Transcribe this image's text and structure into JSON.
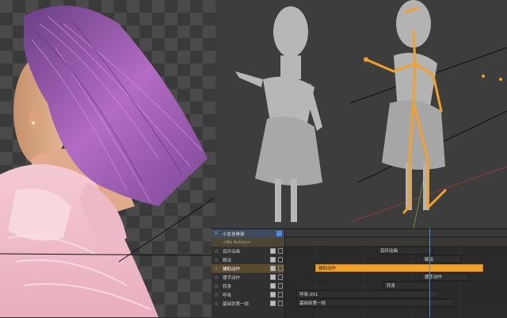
{
  "nla": {
    "tracks": [
      {
        "name": "小女孩骨架",
        "kind": "header"
      },
      {
        "name": "<No Action>",
        "kind": "action"
      },
      {
        "name": "耳环动画",
        "kind": "track"
      },
      {
        "name": "眼译",
        "kind": "track"
      },
      {
        "name": "辅助动作",
        "kind": "active"
      },
      {
        "name": "摆手动作",
        "kind": "track"
      },
      {
        "name": "转身",
        "kind": "track"
      },
      {
        "name": "呼吸",
        "kind": "track"
      },
      {
        "name": "基础到第一帧",
        "kind": "track"
      }
    ],
    "strips": [
      {
        "label": "耳环动画",
        "lane": 2,
        "style": "dark"
      },
      {
        "label": "眼译",
        "lane": 3,
        "style": "dark"
      },
      {
        "label": "辅助动作",
        "lane": 4,
        "style": "orange"
      },
      {
        "label": "摆手动作",
        "lane": 5,
        "style": "dark"
      },
      {
        "label": "转身",
        "lane": 6,
        "style": "dark"
      },
      {
        "label": "呼吸.001",
        "lane": 7,
        "style": "dark"
      },
      {
        "label": "基础到第一帧",
        "lane": 8,
        "style": "dark"
      }
    ]
  },
  "colors": {
    "accent_orange": "#f2a22b",
    "playhead_blue": "#4b8cd6",
    "hair_purple": "#a35bb5",
    "dress_pink": "#f0c3cf"
  }
}
